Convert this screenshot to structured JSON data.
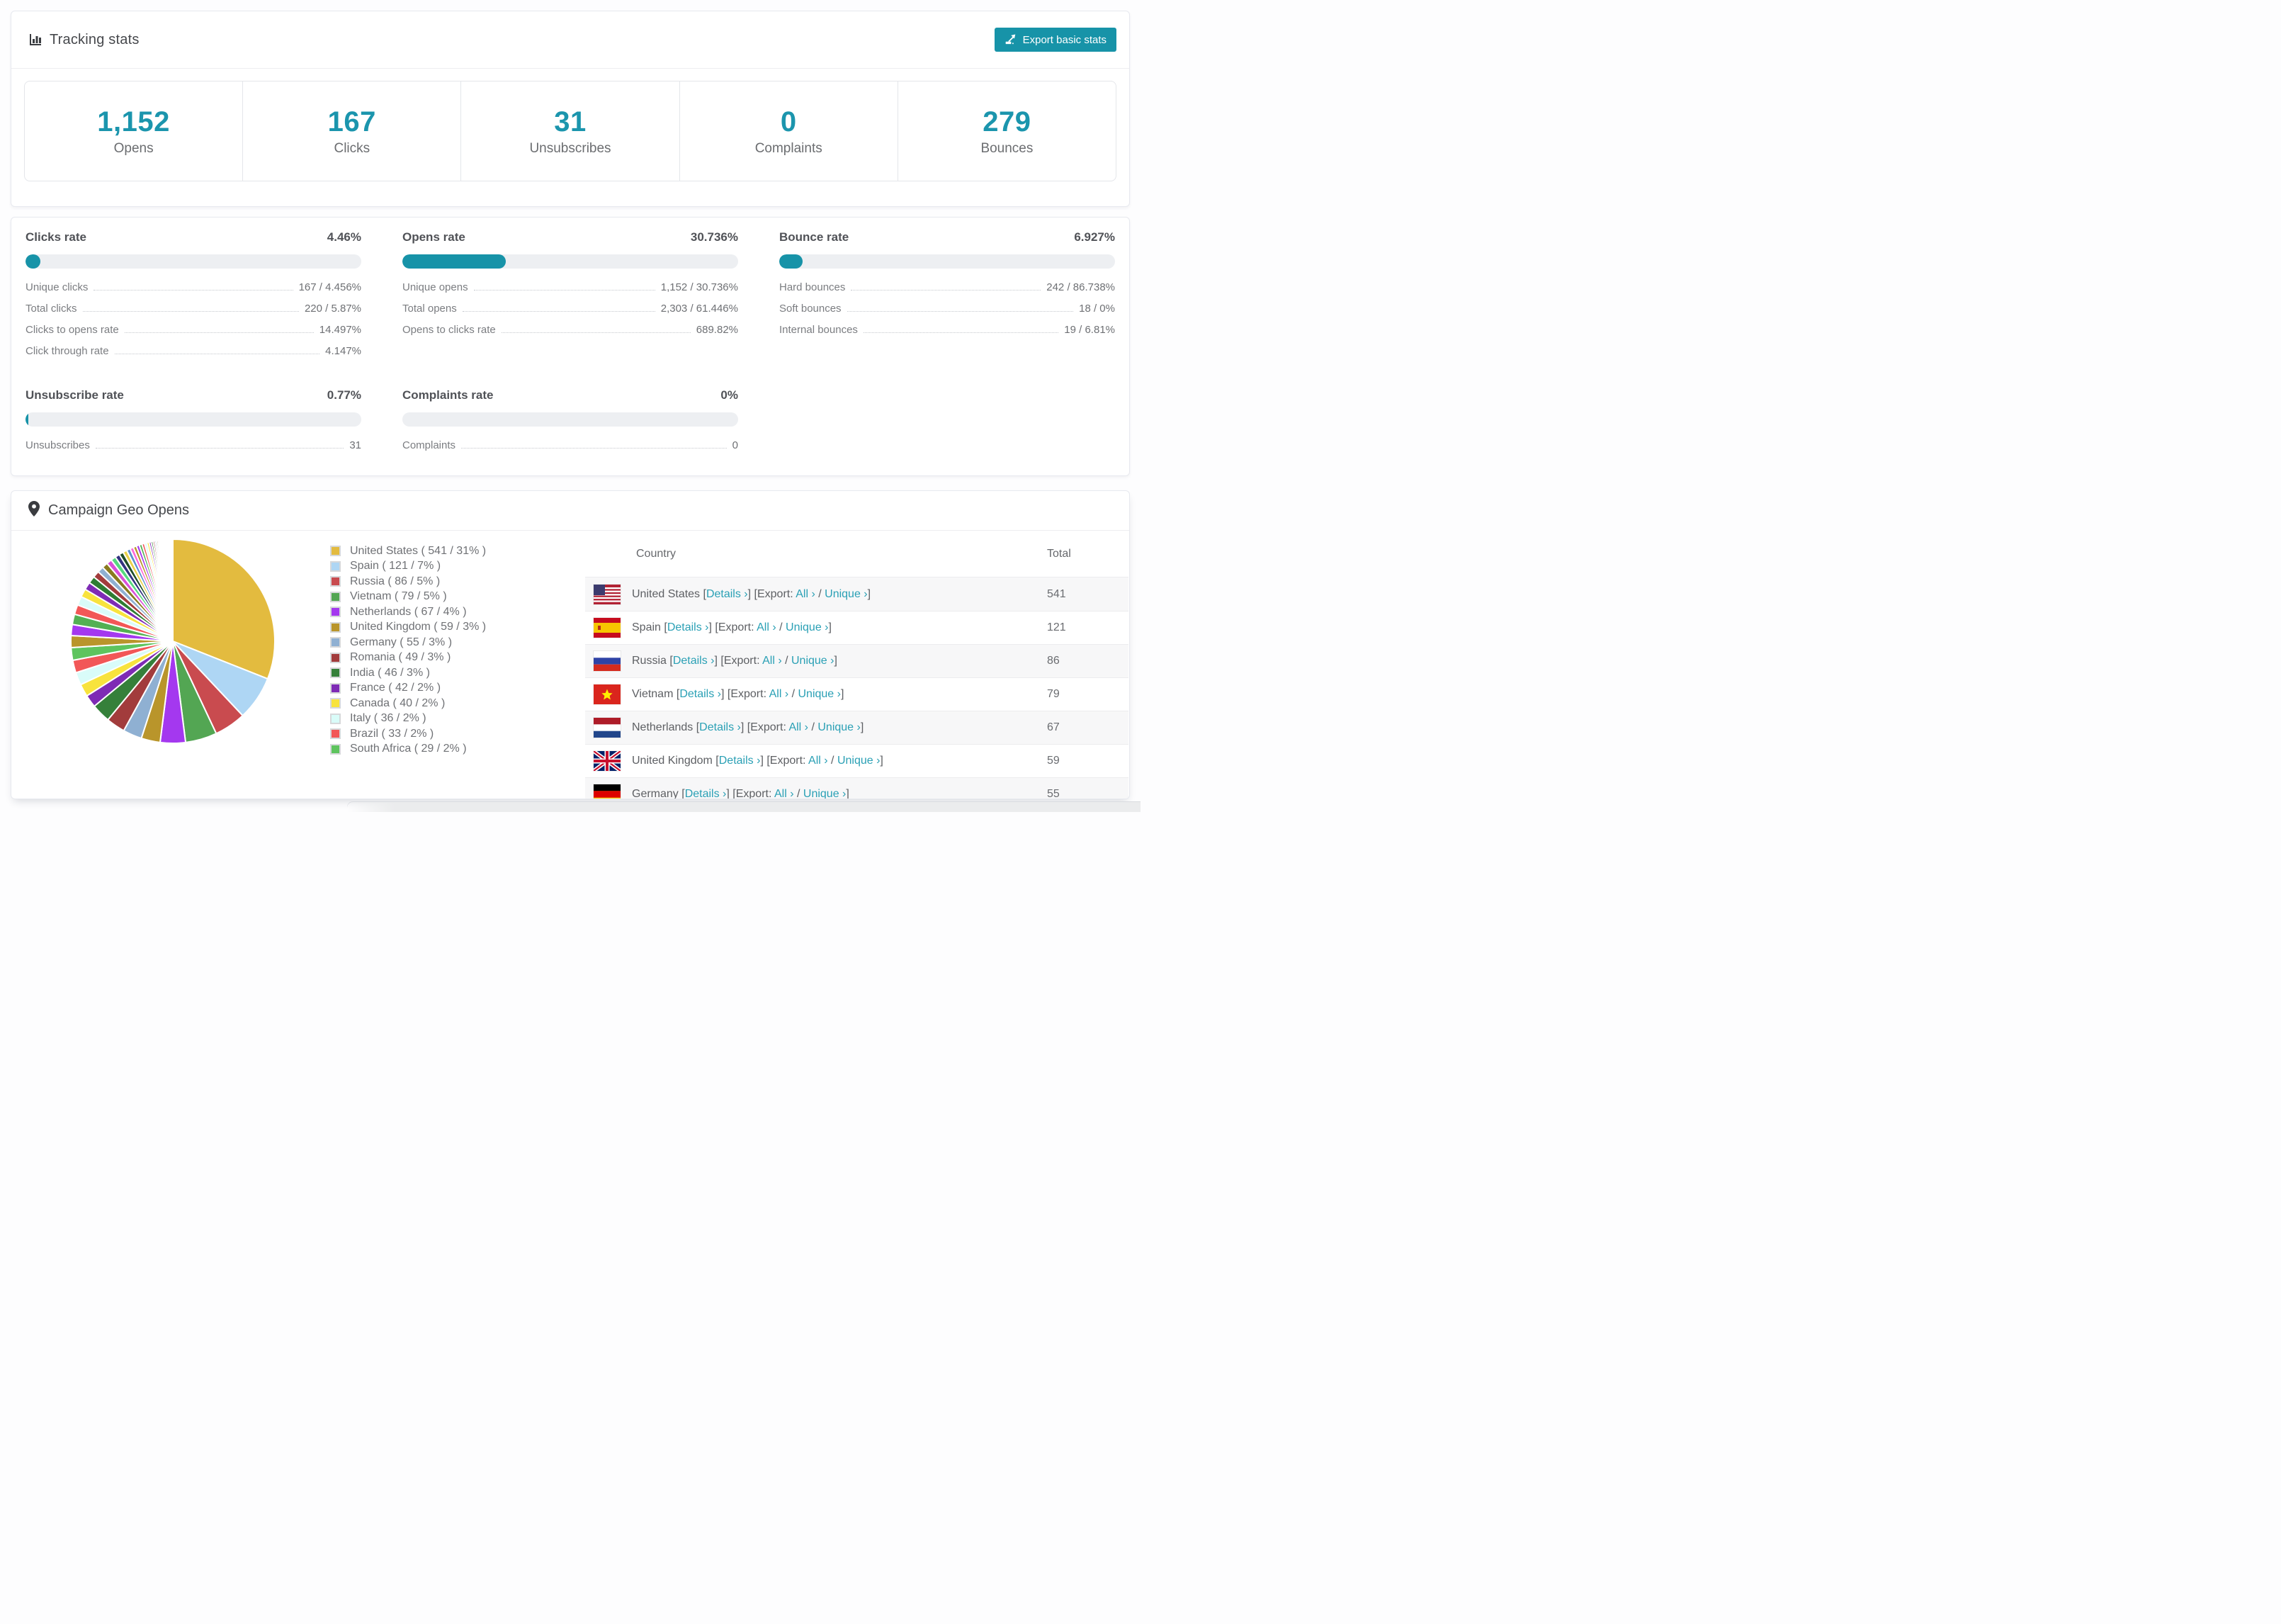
{
  "accent_color": "#1793a8",
  "link_color": "#2aa0b5",
  "stat_number_color": "#1b95ad",
  "header": {
    "title": "Tracking stats",
    "title_icon": "bar-chart-icon",
    "export_button_label": "Export basic stats"
  },
  "stats": [
    {
      "value": "1,152",
      "label": "Opens"
    },
    {
      "value": "167",
      "label": "Clicks"
    },
    {
      "value": "31",
      "label": "Unsubscribes"
    },
    {
      "value": "0",
      "label": "Complaints"
    },
    {
      "value": "279",
      "label": "Bounces"
    }
  ],
  "rates": [
    {
      "title": "Clicks rate",
      "value": "4.46%",
      "pct": 4.46,
      "rows": [
        [
          "Unique clicks",
          "167 / 4.456%"
        ],
        [
          "Total clicks",
          "220 / 5.87%"
        ],
        [
          "Clicks to opens rate",
          "14.497%"
        ],
        [
          "Click through rate",
          "4.147%"
        ]
      ]
    },
    {
      "title": "Opens rate",
      "value": "30.736%",
      "pct": 30.736,
      "rows": [
        [
          "Unique opens",
          "1,152 / 30.736%"
        ],
        [
          "Total opens",
          "2,303 / 61.446%"
        ],
        [
          "Opens to clicks rate",
          "689.82%"
        ]
      ]
    },
    {
      "title": "Bounce rate",
      "value": "6.927%",
      "pct": 6.927,
      "rows": [
        [
          "Hard bounces",
          "242 / 86.738%"
        ],
        [
          "Soft bounces",
          "18 / 0%"
        ],
        [
          "Internal bounces",
          "19 / 6.81%"
        ]
      ]
    },
    {
      "title": "Unsubscribe rate",
      "value": "0.77%",
      "pct": 0.77,
      "rows": [
        [
          "Unsubscribes",
          "31"
        ]
      ]
    },
    {
      "title": "Complaints rate",
      "value": "0%",
      "pct": 0,
      "rows": [
        [
          "Complaints",
          "0"
        ]
      ]
    }
  ],
  "geo": {
    "title": "Campaign Geo Opens",
    "title_icon": "map-pin-icon",
    "legend": [
      {
        "label": "United States ( 541 / 31% )",
        "color": "#e3bb3f"
      },
      {
        "label": "Spain ( 121 / 7% )",
        "color": "#aed6f4"
      },
      {
        "label": "Russia ( 86 / 5% )",
        "color": "#c94b4f"
      },
      {
        "label": "Vietnam ( 79 / 5% )",
        "color": "#53a653"
      },
      {
        "label": "Netherlands ( 67 / 4% )",
        "color": "#a438ef"
      },
      {
        "label": "United Kingdom ( 59 / 3% )",
        "color": "#b9952b"
      },
      {
        "label": "Germany ( 55 / 3% )",
        "color": "#8fb0d2"
      },
      {
        "label": "Romania ( 49 / 3% )",
        "color": "#a23c3c"
      },
      {
        "label": "India ( 46 / 3% )",
        "color": "#35803a"
      },
      {
        "label": "France ( 42 / 2% )",
        "color": "#7e2bb5"
      },
      {
        "label": "Canada ( 40 / 2% )",
        "color": "#f8e33d"
      },
      {
        "label": "Italy ( 36 / 2% )",
        "color": "#d9fcf9"
      },
      {
        "label": "Brazil ( 33 / 2% )",
        "color": "#f25757"
      },
      {
        "label": "South Africa ( 29 / 2% )",
        "color": "#5ec45e"
      }
    ],
    "table": {
      "headers": [
        "Country",
        "Total"
      ],
      "link_text": {
        "open": "[",
        "close": "]",
        "details": "Details ›",
        "export_prefix": "[Export:",
        "all": "All ›",
        "slash": " / ",
        "unique": "Unique ›"
      },
      "rows": [
        {
          "country": "United States",
          "flag": "us",
          "total": "541"
        },
        {
          "country": "Spain",
          "flag": "es",
          "total": "121"
        },
        {
          "country": "Russia",
          "flag": "ru",
          "total": "86"
        },
        {
          "country": "Vietnam",
          "flag": "vn",
          "total": "79"
        },
        {
          "country": "Netherlands",
          "flag": "nl",
          "total": "67"
        },
        {
          "country": "United Kingdom",
          "flag": "gb",
          "total": "59"
        },
        {
          "country": "Germany",
          "flag": "de",
          "total": "55"
        }
      ]
    }
  },
  "chart_data": {
    "type": "pie",
    "title": "Campaign Geo Opens",
    "unit": "opens",
    "start_angle_deg": -90,
    "direction": "clockwise",
    "gap_stroke": "#ffffff",
    "legend_position": "right",
    "slices": [
      {
        "label": "United States",
        "value": 541,
        "pct": 31,
        "color": "#e3bb3f"
      },
      {
        "label": "Spain",
        "value": 121,
        "pct": 7,
        "color": "#aed6f4"
      },
      {
        "label": "Russia",
        "value": 86,
        "pct": 5,
        "color": "#c94b4f"
      },
      {
        "label": "Vietnam",
        "value": 79,
        "pct": 5,
        "color": "#53a653"
      },
      {
        "label": "Netherlands",
        "value": 67,
        "pct": 4,
        "color": "#a438ef"
      },
      {
        "label": "United Kingdom",
        "value": 59,
        "pct": 3,
        "color": "#b9952b"
      },
      {
        "label": "Germany",
        "value": 55,
        "pct": 3,
        "color": "#8fb0d2"
      },
      {
        "label": "Romania",
        "value": 49,
        "pct": 3,
        "color": "#a23c3c"
      },
      {
        "label": "India",
        "value": 46,
        "pct": 3,
        "color": "#35803a"
      },
      {
        "label": "France",
        "value": 42,
        "pct": 2,
        "color": "#7e2bb5"
      },
      {
        "label": "Canada",
        "value": 40,
        "pct": 2,
        "color": "#f8e33d"
      },
      {
        "label": "Italy",
        "value": 36,
        "pct": 2,
        "color": "#d9fcf9"
      },
      {
        "label": "Brazil",
        "value": 33,
        "pct": 2,
        "color": "#f25757"
      },
      {
        "label": "South Africa",
        "value": 29,
        "pct": 2,
        "color": "#5ec45e"
      }
    ],
    "others": {
      "pct_total": 26,
      "count": 46,
      "decay": 0.93,
      "palette": [
        "#b9952b",
        "#a438ef",
        "#53b053",
        "#f25757",
        "#d9fcf9",
        "#f8e33d",
        "#7e2bb5",
        "#2e7d32",
        "#a23c3c",
        "#8fb0d2",
        "#8a7a1f",
        "#d94fd9",
        "#56d97f",
        "#32327f",
        "#1e4d28",
        "#e9d24a",
        "#5a8fd0",
        "#ff66d9"
      ]
    }
  }
}
